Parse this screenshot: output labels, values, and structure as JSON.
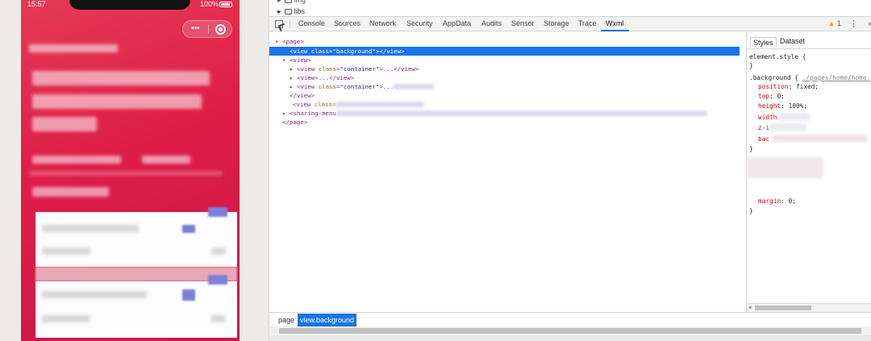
{
  "status_bar": {
    "time": "15:57",
    "battery": "100%"
  },
  "file_tree": {
    "items": [
      "img",
      "libs"
    ]
  },
  "devtools_tabs": [
    "Console",
    "Sources",
    "Network",
    "Security",
    "AppData",
    "Audits",
    "Sensor",
    "Storage",
    "Trace",
    "Wxml"
  ],
  "active_tab": "Wxml",
  "warning_count": "1",
  "more_label": "»",
  "wxml": {
    "page_open": "<page>",
    "sel_open_tag": "<view",
    "sel_attr_name": "class",
    "sel_attr_value": "\"background\"",
    "sel_close": "></view>",
    "view_open": "<view>",
    "row1_tag": "<view",
    "row1_attr": "class",
    "row1_value": "\"container\"",
    "row1_rest": ">...</view>",
    "row2": "<view>...</view>",
    "row3_tag": "<view",
    "row3_attr": "class",
    "row3_value": "\"container\"",
    "row3_rest": ">...",
    "view_close": "</view>",
    "row5_tag": "<view",
    "row5_attr": "class=",
    "sharing": "<sharing-menu",
    "page_close": "</page>"
  },
  "styles": {
    "tabs": [
      "Styles",
      "Dataset"
    ],
    "element_style": "element.style {",
    "close_brace": "}",
    "rule_selector": ".background {",
    "rule_source": "./pages/home/home.",
    "props": [
      {
        "name": "position",
        "value": "fixed;"
      },
      {
        "name": "top",
        "value": "0;"
      },
      {
        "name": "height",
        "value": "100%;"
      },
      {
        "name": "width",
        "value": ""
      },
      {
        "name": "z-i",
        "value": ""
      },
      {
        "name": "bac",
        "value": ""
      }
    ],
    "margin": {
      "name": "margin",
      "value": "0;"
    }
  },
  "breadcrumbs": [
    "page",
    "view.background"
  ]
}
